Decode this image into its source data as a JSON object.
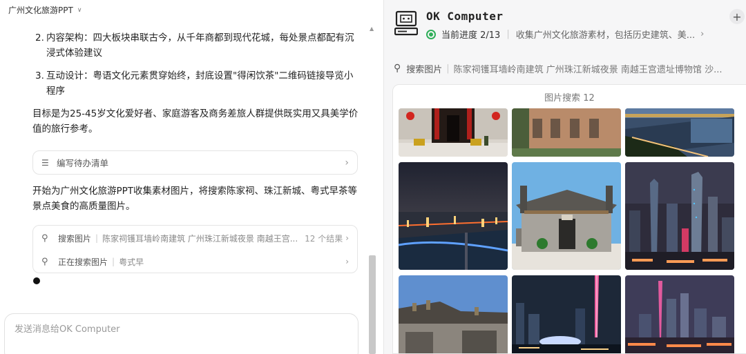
{
  "left": {
    "doc_title": "广州文化旅游PPT",
    "list": [
      {
        "num": "2.",
        "text": "内容架构：四大板块串联古今，从千年商都到现代花城，每处景点都配有沉浸式体验建议"
      },
      {
        "num": "3.",
        "text": "互动设计：粤语文化元素贯穿始终，封底设置\"得闲饮茶\"二维码链接导览小程序"
      }
    ],
    "goal_text": "目标是为25-45岁文化爱好者、家庭游客及商务差旅人群提供既实用又具美学价值的旅行参考。",
    "todo_card": {
      "icon": "list-icon",
      "label": "编写待办清单"
    },
    "start_text": "开始为广州文化旅游PPT收集素材图片，将搜索陈家祠、珠江新城、粤式早茶等景点美食的高质量图片。",
    "search_card": {
      "row1": {
        "icon": "search-icon",
        "label": "搜索图片",
        "query": "陈家祠镬耳墙岭南建筑 广州珠江新城夜景 南越王宫...",
        "count": "12 个结果"
      },
      "row2": {
        "icon": "searching-icon",
        "label": "正在搜索图片",
        "query": "粤式早"
      }
    },
    "input_placeholder": "发送消息给OK Computer"
  },
  "right": {
    "title": "OK Computer",
    "progress_label": "当前进度 2/13",
    "task_text": "收集广州文化旅游素材，包括历史建筑、美...",
    "search_label": "搜索图片",
    "search_query": "陈家祠镬耳墙岭南建筑 广州珠江新城夜景 南越王宫遗址博物馆 沙...",
    "results_header": "图片搜索 12",
    "images": [
      {
        "name": "chen-clan-temple-gate-image"
      },
      {
        "name": "colonial-building-image"
      },
      {
        "name": "pearl-river-dusk-image"
      },
      {
        "name": "pearl-river-night-aerial-image"
      },
      {
        "name": "lingnan-ancestral-hall-image"
      },
      {
        "name": "zhujiang-new-town-night-image"
      },
      {
        "name": "chen-clan-roof-ridge-image"
      },
      {
        "name": "canton-tower-night-image"
      },
      {
        "name": "guangzhou-skyline-night-image"
      }
    ]
  },
  "colors": {
    "accent_green": "#2fae59",
    "border": "#e4e4e4",
    "panel_bg": "#f6f6f7"
  }
}
